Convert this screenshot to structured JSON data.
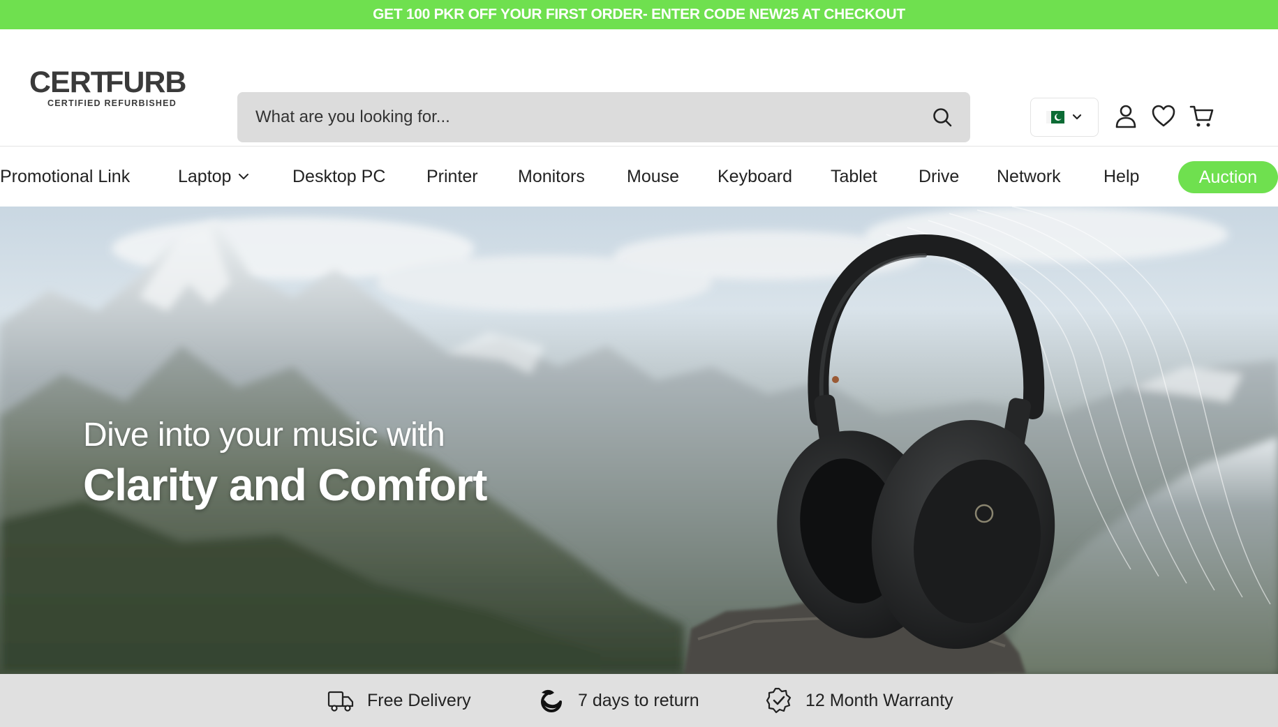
{
  "promo": {
    "text": "GET 100 PKR OFF YOUR FIRST ORDER- ENTER CODE NEW25 AT CHECKOUT",
    "color": "#6fe04f"
  },
  "header": {
    "logo": {
      "word_left": "CERT",
      "word_right": "FURB",
      "tagline": "CERTIFIED REFURBISHED"
    },
    "search": {
      "placeholder": "What are you looking for..."
    },
    "country": {
      "flag": "pakistan-flag-icon"
    },
    "icons": [
      "user-icon",
      "heart-icon",
      "cart-icon"
    ]
  },
  "nav": {
    "items": [
      {
        "label": "Promotional Link"
      },
      {
        "label": "Laptop",
        "has_dropdown": true
      },
      {
        "label": "Desktop PC"
      },
      {
        "label": "Printer"
      },
      {
        "label": "Monitors"
      },
      {
        "label": "Mouse"
      },
      {
        "label": "Keyboard"
      },
      {
        "label": "Tablet"
      },
      {
        "label": "Drive"
      },
      {
        "label": "Network"
      },
      {
        "label": "Help"
      }
    ],
    "auction": {
      "label": "Auction",
      "color": "#6fe04f"
    }
  },
  "hero": {
    "subtitle": "Dive into your music with",
    "title": "Clarity and Comfort"
  },
  "features": [
    {
      "label": "Free Delivery",
      "icon": "truck-icon"
    },
    {
      "label": "7 days to return",
      "icon": "return-icon"
    },
    {
      "label": "12 Month Warranty",
      "icon": "warranty-badge-icon"
    }
  ]
}
